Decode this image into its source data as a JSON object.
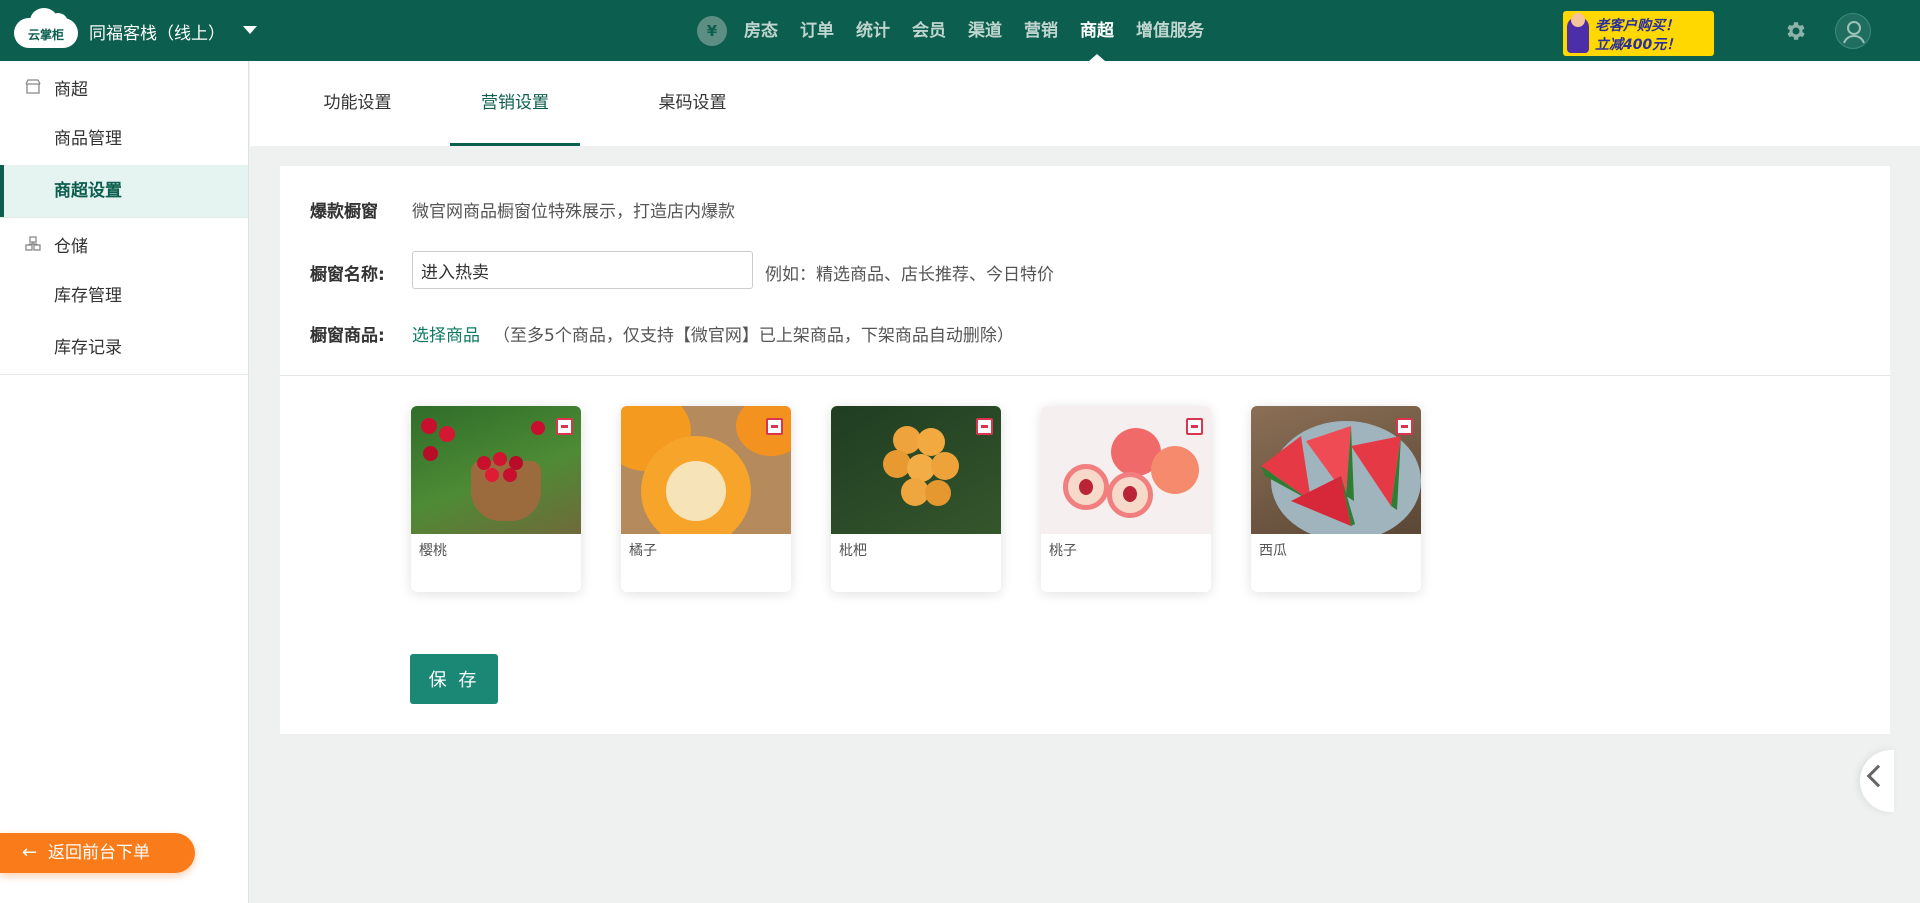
{
  "header": {
    "logo_text": "云掌柜",
    "hotel_name": "同福客栈（线上）",
    "currency_symbol": "¥",
    "nav": [
      "房态",
      "订单",
      "统计",
      "会员",
      "渠道",
      "营销",
      "商超",
      "增值服务"
    ],
    "active_nav": "商超",
    "promo_line1": "老客户购买！",
    "promo_line2": "立减400元！"
  },
  "sidebar": {
    "groups": [
      {
        "label": "商超",
        "icon": "store-icon",
        "items": [
          "商品管理",
          "商超设置"
        ]
      },
      {
        "label": "仓储",
        "icon": "warehouse-icon",
        "items": [
          "库存管理",
          "库存记录"
        ]
      }
    ],
    "active_item": "商超设置",
    "back_button": "返回前台下单"
  },
  "tabs": [
    "功能设置",
    "营销设置",
    "桌码设置"
  ],
  "active_tab": "营销设置",
  "form": {
    "section_label": "爆款橱窗",
    "section_desc": "微官网商品橱窗位特殊展示，打造店内爆款",
    "name_label": "橱窗名称:",
    "name_value": "进入热卖",
    "name_hint": "例如：精选商品、店长推荐、今日特价",
    "goods_label": "橱窗商品:",
    "goods_link": "选择商品",
    "goods_hint": "（至多5个商品，仅支持【微官网】已上架商品，下架商品自动删除）",
    "save_label": "保 存"
  },
  "goods": [
    {
      "name": "樱桃",
      "image": "cherry"
    },
    {
      "name": "橘子",
      "image": "orange"
    },
    {
      "name": "枇杷",
      "image": "loquat"
    },
    {
      "name": "桃子",
      "image": "peach"
    },
    {
      "name": "西瓜",
      "image": "watermelon"
    }
  ],
  "colors": {
    "brand": "#0c5e4e",
    "accent": "#1a8874",
    "back_button": "#f97b1a",
    "remove": "#d9364e"
  }
}
